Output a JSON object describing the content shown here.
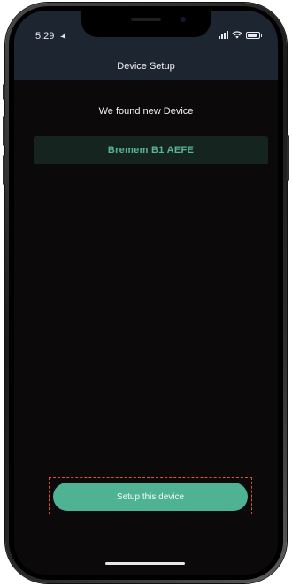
{
  "status_bar": {
    "time": "5:29",
    "location_icon": "location-arrow-icon",
    "signal_icon": "cellular-signal-icon",
    "wifi_icon": "wifi-icon",
    "battery_icon": "battery-icon",
    "battery_level": 0.85
  },
  "header": {
    "title": "Device Setup"
  },
  "main": {
    "message": "We found new Device",
    "device_name": "Bremem B1 AEFE",
    "setup_button_label": "Setup this device"
  },
  "colors": {
    "header_background": "#1d2530",
    "screen_background": "#0b0909",
    "accent": "#4eb293",
    "device_card_background": "#16241f",
    "device_name_text": "#56b597",
    "highlight_outline": "#e0522d"
  }
}
